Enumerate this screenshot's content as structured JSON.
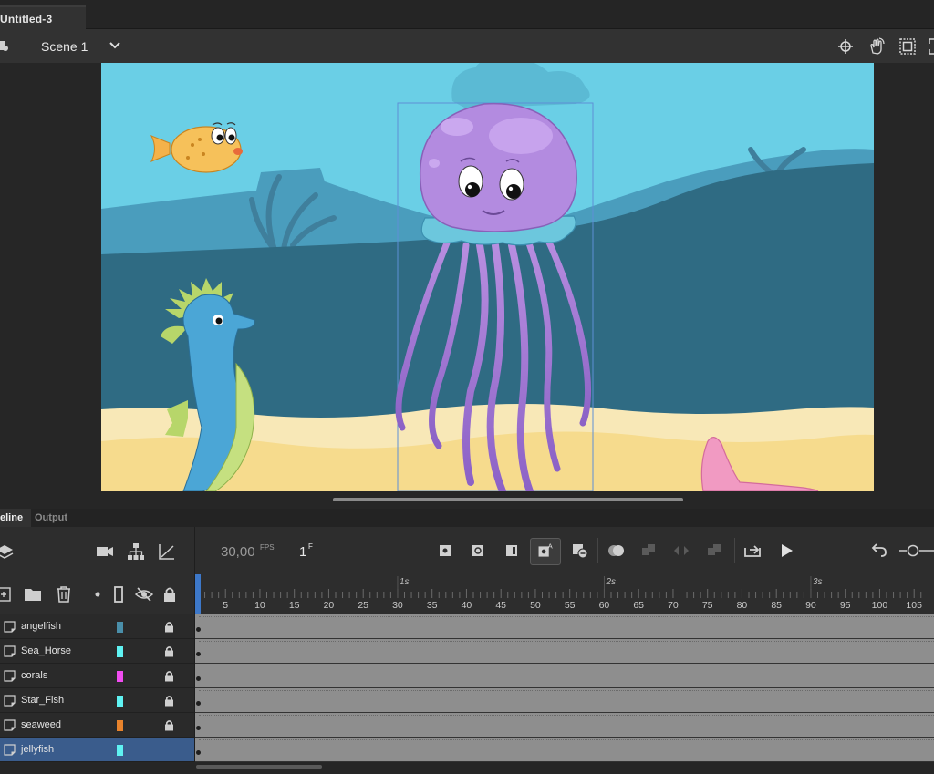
{
  "document": {
    "tab_title": "Untitled-3"
  },
  "editbar": {
    "scene_label": "Scene 1",
    "icons": [
      "scene-stack-icon",
      "chevron-down-icon",
      "center-stage-icon",
      "hand-rotate-icon",
      "clip-content-icon",
      "fit-icon"
    ]
  },
  "stage": {
    "background_color": "#6acfe6",
    "characters": [
      "angelfish",
      "seahorse",
      "jellyfish",
      "starfish"
    ]
  },
  "panel": {
    "tabs": [
      {
        "label": "eline",
        "active": true
      },
      {
        "label": "Output",
        "active": false
      }
    ]
  },
  "timeline": {
    "fps": "30,00",
    "fps_unit": "FPS",
    "current_frame": "1",
    "frame_unit": "F",
    "second_labels": [
      "1s",
      "2s",
      "3s"
    ],
    "frame_ticks": [
      "5",
      "10",
      "15",
      "20",
      "25",
      "30",
      "35",
      "40",
      "45",
      "50",
      "55",
      "60",
      "65",
      "70",
      "75",
      "80",
      "85",
      "90",
      "95",
      "100",
      "105"
    ],
    "layers": [
      {
        "name": "angelfish",
        "color": "#4a8faa",
        "locked": true,
        "selected": false
      },
      {
        "name": "Sea_Horse",
        "color": "#5ff2f2",
        "locked": true,
        "selected": false
      },
      {
        "name": "corals",
        "color": "#f04cf0",
        "locked": true,
        "selected": false
      },
      {
        "name": "Star_Fish",
        "color": "#5ff2f2",
        "locked": true,
        "selected": false
      },
      {
        "name": "seaweed",
        "color": "#e8832c",
        "locked": true,
        "selected": false
      },
      {
        "name": "jellyfish",
        "color": "#5ff2f2",
        "locked": false,
        "selected": true
      }
    ]
  }
}
